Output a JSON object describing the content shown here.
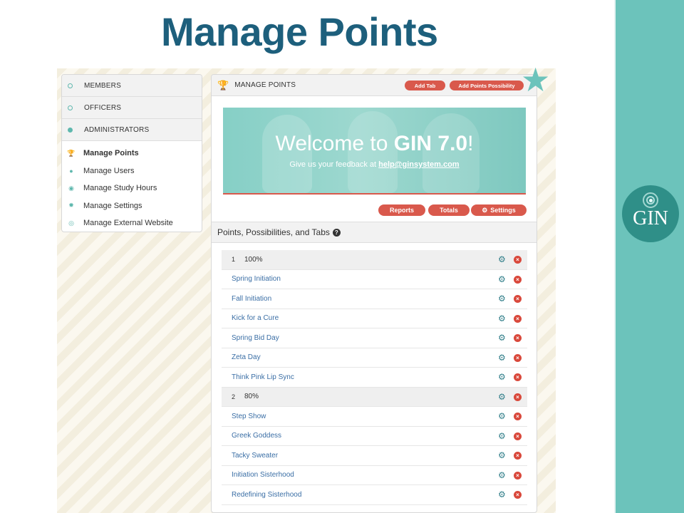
{
  "slide": {
    "title": "Manage Points",
    "logo_text": "GIN",
    "accent_color": "#6cc3bb",
    "title_color": "#1d5f7c"
  },
  "sidebar": {
    "sections": [
      {
        "label": "MEMBERS",
        "filled": false
      },
      {
        "label": "OFFICERS",
        "filled": false
      },
      {
        "label": "ADMINISTRATORS",
        "filled": true
      }
    ],
    "items": [
      {
        "label": "Manage Points",
        "icon": "trophy-icon",
        "active": true
      },
      {
        "label": "Manage Users",
        "icon": "users-icon",
        "active": false
      },
      {
        "label": "Manage Study Hours",
        "icon": "clock-icon",
        "active": false
      },
      {
        "label": "Manage Settings",
        "icon": "gear-icon",
        "active": false
      },
      {
        "label": "Manage External Website",
        "icon": "globe-icon",
        "active": false
      }
    ]
  },
  "main": {
    "header_title": "MANAGE POINTS",
    "add_tab_label": "Add Tab",
    "add_possibility_label": "Add Points Possibility",
    "banner": {
      "title_prefix": "Welcome to ",
      "title_brand": "GIN 7.0",
      "title_suffix": "!",
      "subtitle_prefix": "Give us your feedback at ",
      "subtitle_email": "help@ginsystem.com"
    },
    "reports_label": "Reports",
    "totals_label": "Totals",
    "settings_label": "Settings",
    "section_title": "Points, Possibilities, and Tabs",
    "rows": [
      {
        "type": "group",
        "num": "1",
        "label": "100%"
      },
      {
        "type": "item",
        "label": "Spring Initiation"
      },
      {
        "type": "item",
        "label": "Fall Initiation"
      },
      {
        "type": "item",
        "label": "Kick for a Cure"
      },
      {
        "type": "item",
        "label": "Spring Bid Day"
      },
      {
        "type": "item",
        "label": "Zeta Day"
      },
      {
        "type": "item",
        "label": "Think Pink Lip Sync"
      },
      {
        "type": "group",
        "num": "2",
        "label": "80%"
      },
      {
        "type": "item",
        "label": "Step Show"
      },
      {
        "type": "item",
        "label": "Greek Goddess"
      },
      {
        "type": "item",
        "label": "Tacky Sweater"
      },
      {
        "type": "item",
        "label": "Initiation Sisterhood"
      },
      {
        "type": "item",
        "label": "Redefining Sisterhood"
      }
    ]
  }
}
